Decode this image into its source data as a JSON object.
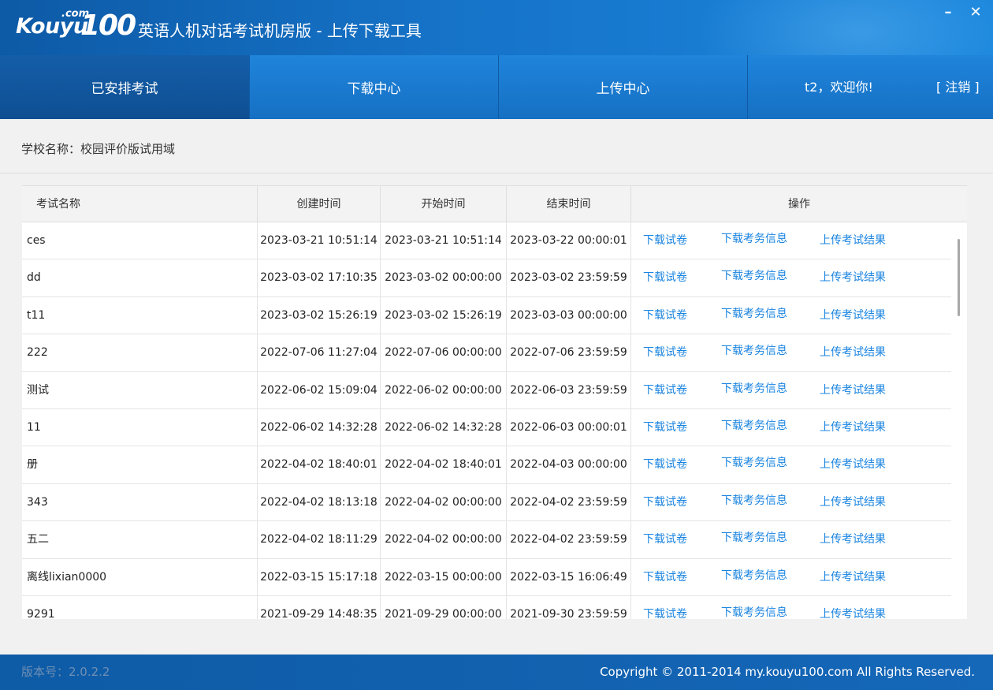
{
  "app": {
    "logo_word": "Kouyu",
    "logo_com": ".com",
    "logo_num": "100",
    "title": "英语人机对话考试机房版 - 上传下载工具",
    "minimize": "–",
    "close": "✕"
  },
  "nav": {
    "tabs": [
      {
        "label": "已安排考试",
        "active": true
      },
      {
        "label": "下载中心",
        "active": false
      },
      {
        "label": "上传中心",
        "active": false
      }
    ],
    "welcome": "t2，欢迎你!",
    "logout": "[ 注销 ]"
  },
  "school": {
    "label": "学校名称：校园评价版试用域"
  },
  "table": {
    "headers": [
      "考试名称",
      "创建时间",
      "开始时间",
      "结束时间",
      "操作"
    ],
    "actions": [
      "下载试卷",
      "下载考务信息",
      "上传考试结果"
    ],
    "rows": [
      {
        "name": "ces",
        "created": "2023-03-21 10:51:14",
        "start": "2023-03-21 10:51:14",
        "end": "2023-03-22 00:00:01"
      },
      {
        "name": "dd",
        "created": "2023-03-02 17:10:35",
        "start": "2023-03-02 00:00:00",
        "end": "2023-03-02 23:59:59"
      },
      {
        "name": "t11",
        "created": "2023-03-02 15:26:19",
        "start": "2023-03-02 15:26:19",
        "end": "2023-03-03 00:00:00"
      },
      {
        "name": "222",
        "created": "2022-07-06 11:27:04",
        "start": "2022-07-06 00:00:00",
        "end": "2022-07-06 23:59:59"
      },
      {
        "name": "测试",
        "created": "2022-06-02 15:09:04",
        "start": "2022-06-02 00:00:00",
        "end": "2022-06-03 23:59:59"
      },
      {
        "name": "11",
        "created": "2022-06-02 14:32:28",
        "start": "2022-06-02 14:32:28",
        "end": "2022-06-03 00:00:01"
      },
      {
        "name": "册",
        "created": "2022-04-02 18:40:01",
        "start": "2022-04-02 18:40:01",
        "end": "2022-04-03 00:00:00"
      },
      {
        "name": "343",
        "created": "2022-04-02 18:13:18",
        "start": "2022-04-02 00:00:00",
        "end": "2022-04-02 23:59:59"
      },
      {
        "name": "五二",
        "created": "2022-04-02 18:11:29",
        "start": "2022-04-02 00:00:00",
        "end": "2022-04-02 23:59:59"
      },
      {
        "name": "离线lixian0000",
        "created": "2022-03-15 15:17:18",
        "start": "2022-03-15 00:00:00",
        "end": "2022-03-15 16:06:49"
      },
      {
        "name": "9291",
        "created": "2021-09-29 14:48:35",
        "start": "2021-09-29 00:00:00",
        "end": "2021-09-30 23:59:59"
      }
    ]
  },
  "footer": {
    "version": "版本号：2.0.2.2",
    "copyright": "Copyright © 2011-2014 my.kouyu100.com All Rights Reserved."
  }
}
